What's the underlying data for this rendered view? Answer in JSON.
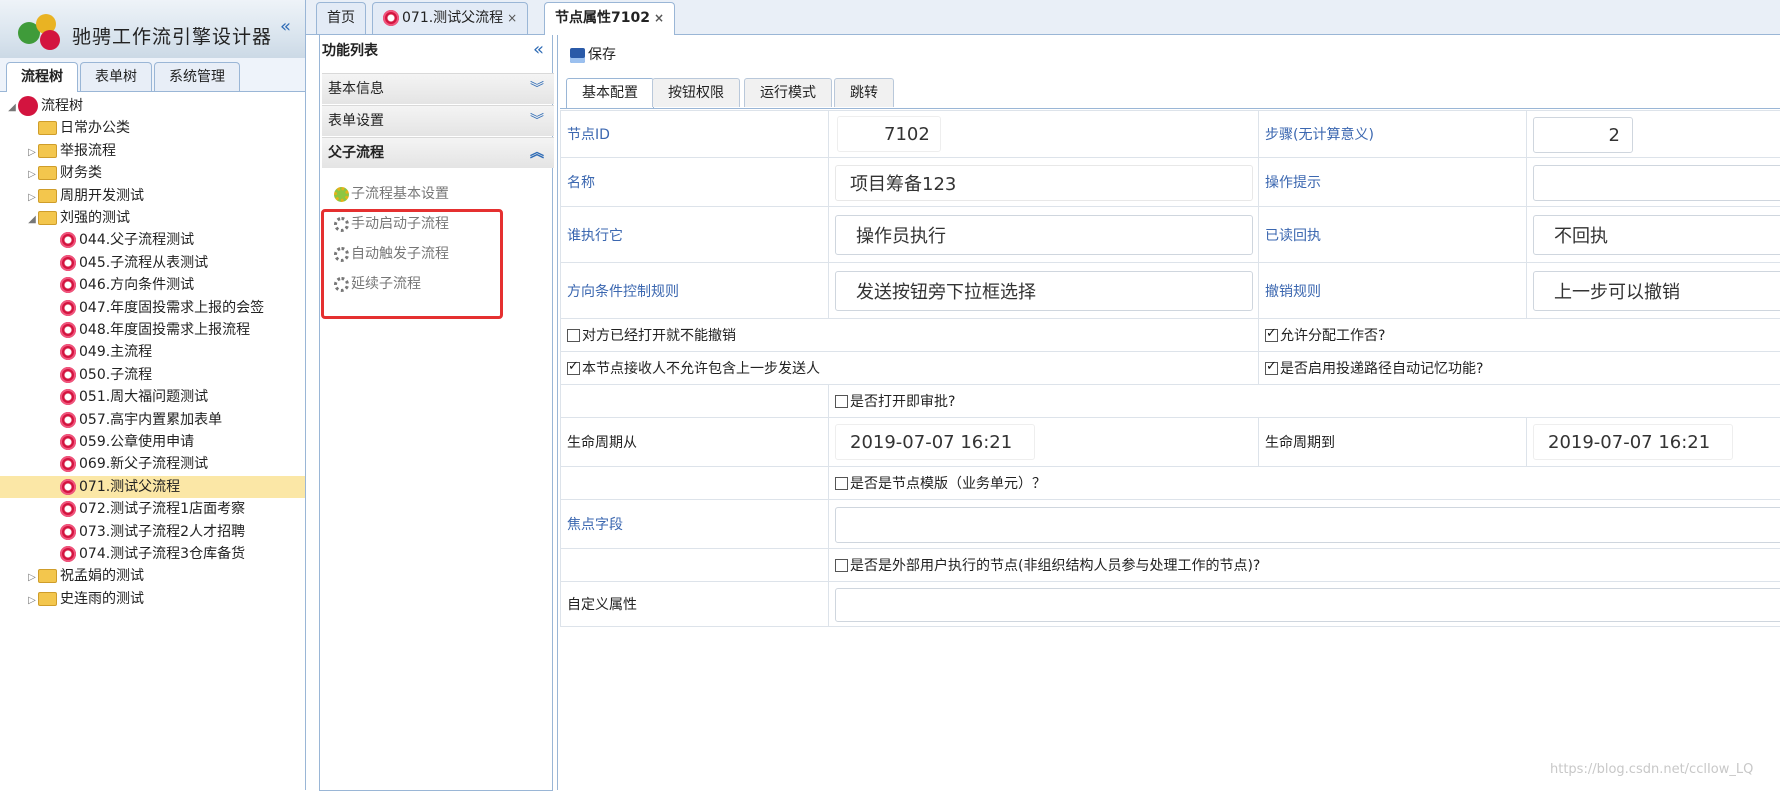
{
  "app": {
    "title": "驰骋工作流引擎设计器"
  },
  "left_tabs": [
    "流程树",
    "表单树",
    "系统管理"
  ],
  "tree": {
    "root": "流程树",
    "folders_top": [
      "日常办公类",
      "举报流程",
      "财务类",
      "周朋开发测试",
      "刘强的测试"
    ],
    "flows": [
      "044.父子流程测试",
      "045.子流程从表测试",
      "046.方向条件测试",
      "047.年度固投需求上报的会签",
      "048.年度固投需求上报流程",
      "049.主流程",
      "050.子流程",
      "051.周大福问题测试",
      "057.高宇内置累加表单",
      "059.公章使用申请",
      "069.新父子流程测试",
      "071.测试父流程",
      "072.测试子流程1店面考察",
      "073.测试子流程2人才招聘",
      "074.测试子流程3仓库备货"
    ],
    "folders_bottom": [
      "祝孟娟的测试",
      "史连雨的测试"
    ]
  },
  "top_tabs": [
    {
      "label": "首页"
    },
    {
      "label": "071.测试父流程",
      "close": "×"
    },
    {
      "label": "节点属性7102",
      "close": "×"
    }
  ],
  "func_list": {
    "title": "功能列表",
    "sections": [
      "基本信息",
      "表单设置",
      "父子流程"
    ],
    "items": [
      "子流程基本设置",
      "手动启动子流程",
      "自动触发子流程",
      "延续子流程"
    ]
  },
  "toolbar": {
    "save_label": "保存"
  },
  "inner_tabs": [
    "基本配置",
    "按钮权限",
    "运行模式",
    "跳转"
  ],
  "form": {
    "node_id_label": "节点ID",
    "node_id": "7102",
    "step_label": "步骤(无计算意义)",
    "step": "2",
    "name_label": "名称",
    "name": "项目筹备123",
    "tip_label": "操作提示",
    "tip": "",
    "who_label": "谁执行它",
    "who": "操作员执行",
    "readback_label": "已读回执",
    "readback": "不回执",
    "dir_label": "方向条件控制规则",
    "dir": "发送按钮旁下拉框选择",
    "undo_label": "撤销规则",
    "undo": "上一步可以撤销",
    "cb1": "对方已经打开就不能撤销",
    "cb2": "允许分配工作否?",
    "cb3": "本节点接收人不允许包含上一步发送人",
    "cb4": "是否启用投递路径自动记忆功能?",
    "cb5": "是否打开即审批?",
    "life_from_label": "生命周期从",
    "life_from": "2019-07-07 16:21",
    "life_to_label": "生命周期到",
    "life_to": "2019-07-07 16:21",
    "cb6": "是否是节点模版（业务单元）？",
    "focus_label": "焦点字段",
    "focus": "",
    "cb7": "是否是外部用户执行的节点(非组织结构人员参与处理工作的节点)?",
    "custom_label": "自定义属性",
    "custom": ""
  },
  "watermark": "https://blog.csdn.net/cclIow_LQ"
}
